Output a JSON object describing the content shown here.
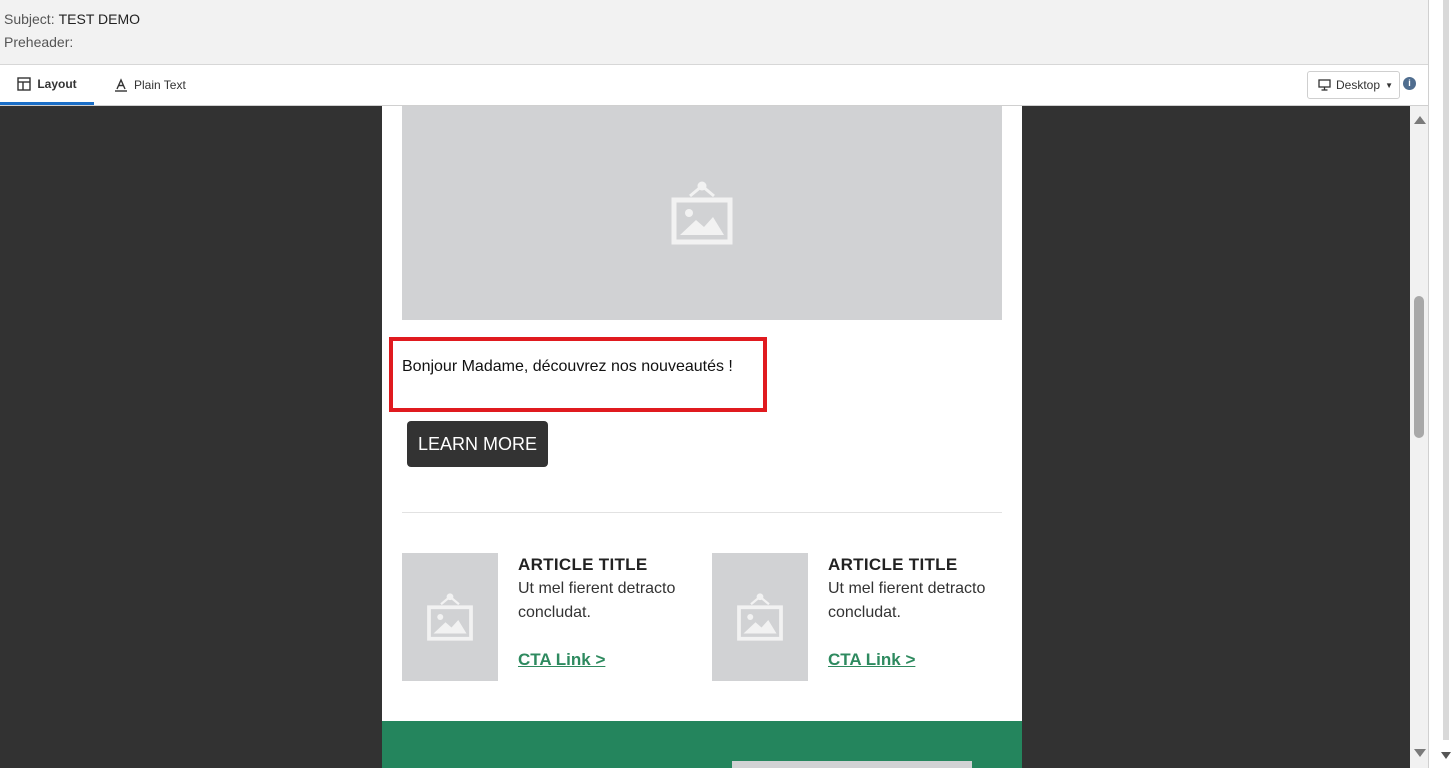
{
  "header": {
    "subject_label": "Subject:",
    "subject_value": "TEST DEMO",
    "preheader_label": "Preheader:",
    "preheader_value": ""
  },
  "tabs": [
    {
      "label": "Layout",
      "icon": "layout-icon",
      "active": true
    },
    {
      "label": "Plain Text",
      "icon": "text-icon",
      "active": false
    }
  ],
  "device_select": {
    "value": "Desktop",
    "icon": "desktop-icon"
  },
  "info_icon": "i",
  "email": {
    "greeting": "Bonjour Madame, découvrez nos nouveautés !",
    "button_label": "LEARN MORE",
    "articles": [
      {
        "title": "ARTICLE TITLE",
        "body": "Ut mel fierent detracto concludat.",
        "cta": "CTA Link >"
      },
      {
        "title": "ARTICLE TITLE",
        "body": "Ut mel fierent detracto concludat.",
        "cta": "CTA Link >"
      }
    ]
  },
  "colors": {
    "canvas_bg": "#323232",
    "button_bg": "#333333",
    "cta_green": "#2e8a5f",
    "footer_green": "#24855d",
    "highlight_red": "#e01a1f",
    "tab_underline": "#1a6ec7"
  }
}
